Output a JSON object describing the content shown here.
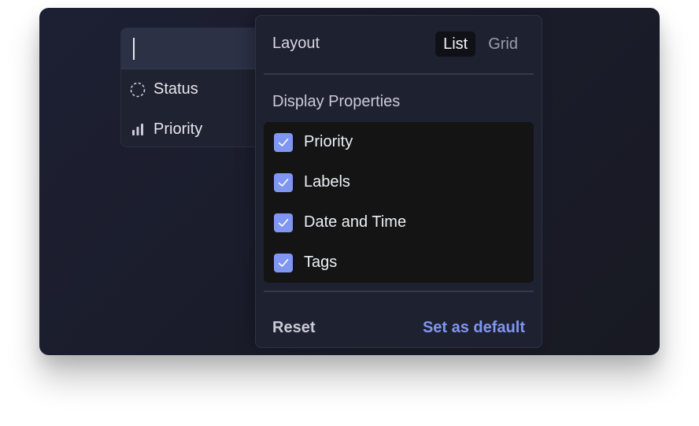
{
  "command_menu": {
    "input_value": "",
    "items": [
      {
        "label": "Status",
        "icon": "dashed-circle-icon"
      },
      {
        "label": "Priority",
        "icon": "signal-bars-icon"
      }
    ]
  },
  "display_popover": {
    "layout_label": "Layout",
    "layout_options": [
      {
        "label": "List",
        "selected": true
      },
      {
        "label": "Grid",
        "selected": false
      }
    ],
    "section_title": "Display Properties",
    "properties": [
      {
        "label": "Priority",
        "checked": true
      },
      {
        "label": "Labels",
        "checked": true
      },
      {
        "label": "Date and Time",
        "checked": true
      },
      {
        "label": "Tags",
        "checked": true
      }
    ],
    "reset_label": "Reset",
    "set_default_label": "Set as default"
  },
  "colors": {
    "accent": "#7f96f2",
    "panel": "#1e2130",
    "props_bg": "#141414"
  }
}
